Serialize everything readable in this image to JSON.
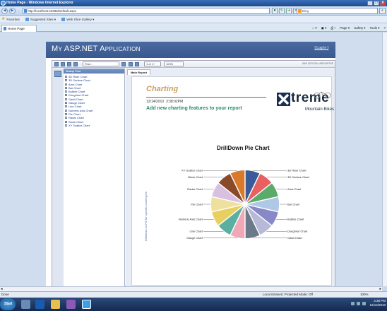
{
  "window": {
    "title": "Home Page - Windows Internet Explorer",
    "address": "http://localhost:43395/Default.aspx",
    "search_placeholder": "Bing",
    "controls": {
      "minimize": "_",
      "maximize": "□",
      "close": "X"
    }
  },
  "favorites_bar": {
    "label": "Favorites",
    "items": [
      "Suggested Sites ▾",
      "Web Slice Gallery ▾"
    ]
  },
  "tab": {
    "label": "Home Page"
  },
  "command_bar": [
    "Page ▾",
    "Safety ▾",
    "Tools ▾",
    "?"
  ],
  "app": {
    "title": "My ASP.NET Application",
    "login": "[ Log In ]"
  },
  "viewer": {
    "find_placeholder": "Find...",
    "page_indicator": "1 of 1+",
    "zoom": "100%",
    "sap_label": "SAP CRYSTAL REPORTS®",
    "group_tree_header": "Group Tree",
    "group_tree_items": [
      "3D Riser Chart",
      "3D Surface Chart",
      "Area Chart",
      "Bar Chart",
      "Bubble Chart",
      "Doughnut Chart",
      "Gantt Chart",
      "Gauge Chart",
      "Line Chart",
      "Numeric Axis Chart",
      "Pie Chart",
      "Radar Chart",
      "Stock Chart",
      "XY Scatter Chart"
    ],
    "report_tab": "Main Report"
  },
  "report": {
    "title": "Charting",
    "date": "12/14/2010",
    "time": "3:38:02PM",
    "subtitle": "Add new charting features to your report",
    "logo_word": "treme",
    "logo_sub": "Mountain Bikes",
    "side_label": "Drilldown on Pie for specific chart types",
    "chart_title": "DrillDown Pie Chart"
  },
  "chart_data": {
    "type": "pie",
    "title": "DrillDown Pie Chart",
    "categories": [
      "3D Riser Chart",
      "3D Surface Chart",
      "Area Chart",
      "Bar Chart",
      "Bubble Chart",
      "Doughnut Chart",
      "Gantt Chart",
      "Gauge Chart",
      "Line Chart",
      "Numeric Axis Chart",
      "Pie Chart",
      "Radar Chart",
      "Block Chart",
      "XY Scatter Chart"
    ],
    "values": [
      1,
      1,
      1,
      1,
      1,
      1,
      1,
      1,
      1,
      1,
      1,
      1,
      1,
      1
    ],
    "colors": [
      "#3a5a9a",
      "#e86060",
      "#5aaa6a",
      "#b0c8e8",
      "#8888c8",
      "#b8b8d8",
      "#6a7a8a",
      "#f0a8b8",
      "#5ab0a0",
      "#e8d060",
      "#f0e0a0",
      "#d8c0e0",
      "#8a4a2a",
      "#d87a2a"
    ]
  },
  "status": {
    "left": "Done",
    "zone": "Local intranet | Protected Mode: Off",
    "zoom": "100%"
  },
  "taskbar": {
    "start": "Start",
    "clock_time": "3:38 PM",
    "clock_date": "12/14/2010"
  }
}
